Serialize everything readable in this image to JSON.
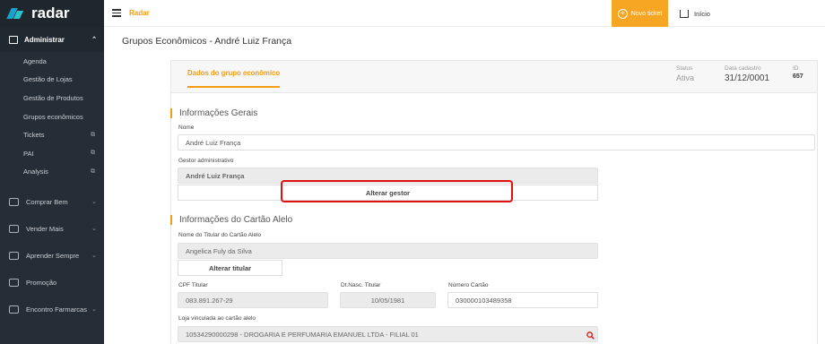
{
  "brand": "radar",
  "sidebar": {
    "section": "Administrar",
    "subitems": [
      {
        "label": "Agenda",
        "ext": false
      },
      {
        "label": "Gestão de Lojas",
        "ext": false
      },
      {
        "label": "Gestão de Produtos",
        "ext": false
      },
      {
        "label": "Grupos econômicos",
        "ext": false
      },
      {
        "label": "Tickets",
        "ext": true
      },
      {
        "label": "PAI",
        "ext": true
      },
      {
        "label": "Analysis",
        "ext": true
      }
    ],
    "groups": [
      "Comprar Bem",
      "Vender Mais",
      "Aprender Sempre",
      "Promoção",
      "Encontro Farmarcas"
    ]
  },
  "topbar": {
    "crumb": "Radar",
    "novo_ticket": "Novo ticket",
    "inicio": "Início"
  },
  "page_title": "Grupos Econômicos - André Luiz França",
  "tab_label": "Dados do grupo econômico",
  "meta": {
    "status_label": "Status",
    "status_value": "Ativa",
    "cadastro_label": "Data cadastro",
    "cadastro_value": "31/12/0001",
    "id_label": "ID",
    "id_value": "657"
  },
  "gerais": {
    "title": "Informações Gerais",
    "nome_label": "Nome",
    "nome_value": "André Luiz França",
    "gestor_label": "Gestor administrativo",
    "gestor_value": "André Luiz França",
    "alterar_gestor": "Alterar gestor"
  },
  "cartao": {
    "title": "Informações do Cartão Alelo",
    "titular_label": "Nome do Titular do Cartão Alelo",
    "titular_value": "Angelica Fuly da Silva",
    "alterar_titular": "Alterar titular",
    "cpf_label": "CPF Titular",
    "cpf_value": "083.891.267-29",
    "dtnasc_label": "Dt.Nasc. Titular",
    "dtnasc_value": "10/05/1981",
    "numero_label": "Número Cartão",
    "numero_value": "030000103489358",
    "loja_label": "Loja vinculada ao cartão alelo",
    "loja_value": "10534290000298 -  DROGARIA E PERFUMARIA EMANUEL LTDA - FILIAL 01"
  },
  "colors": {
    "accent": "#f39c12",
    "sidebar": "#252d36",
    "highlight": "#e01010"
  }
}
